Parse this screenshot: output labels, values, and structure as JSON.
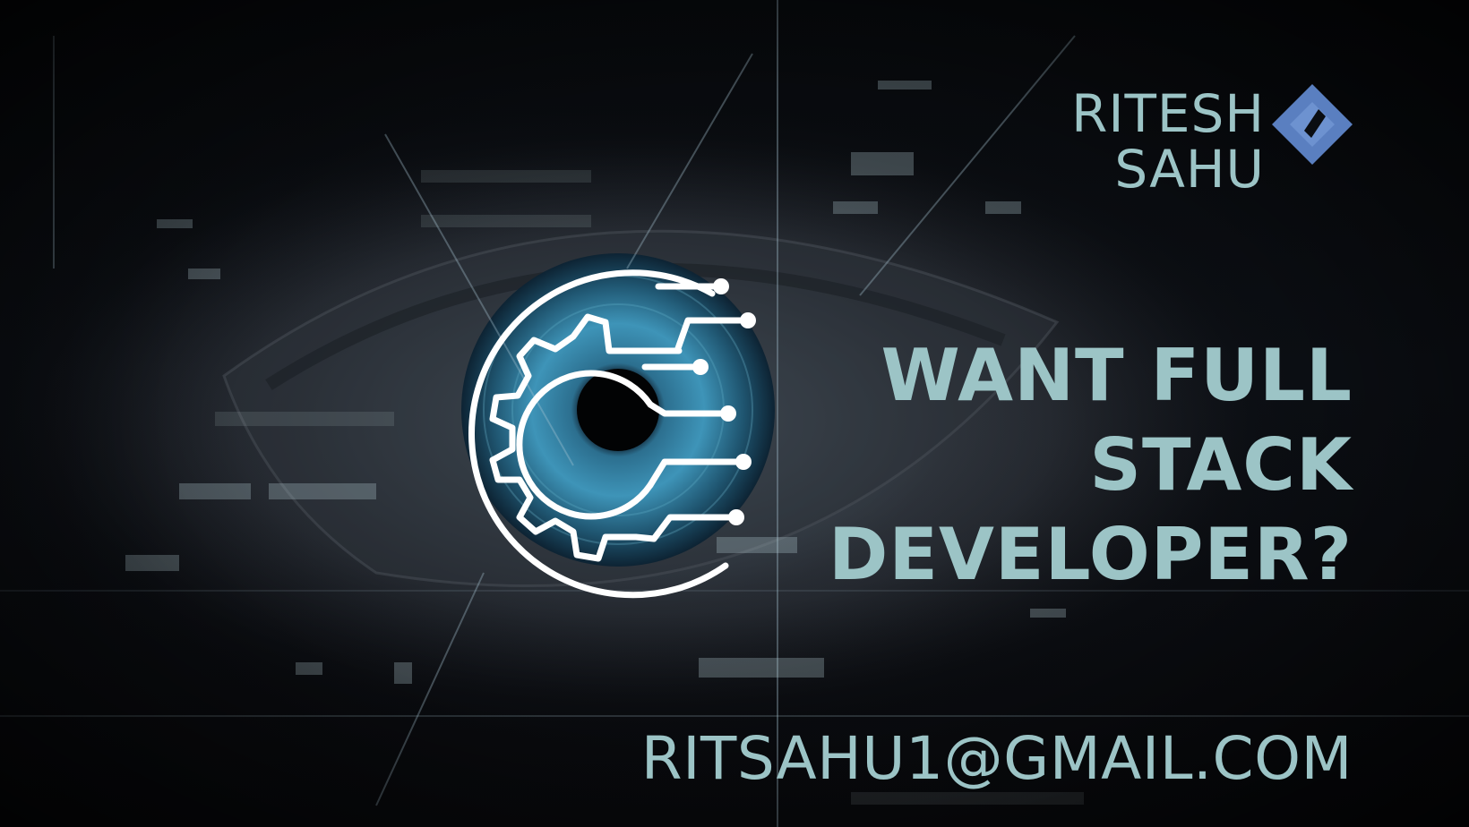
{
  "brand": {
    "first_name": "RITESH",
    "last_name": "SAHU",
    "logo_icon": "diamond-logo-icon"
  },
  "headline": {
    "line1": "WANT FULL",
    "line2": "STACK",
    "line3": "DEVELOPER?"
  },
  "contact": {
    "email": "RITSAHU1@GMAIL.COM"
  },
  "emblem": {
    "icon": "gear-circuit-eye-icon"
  },
  "colors": {
    "text_accent": "#9cc4c6",
    "logo_blue": "#5a7fc0",
    "background": "#05070a",
    "emblem_stroke": "#ffffff"
  }
}
